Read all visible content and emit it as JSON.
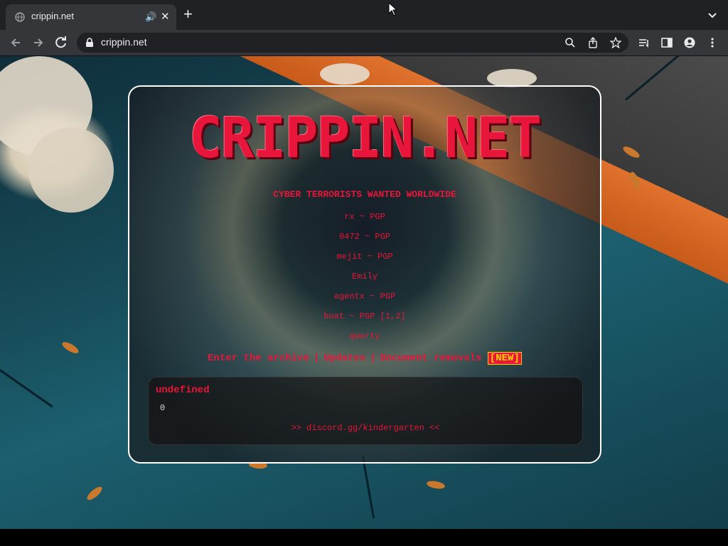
{
  "browser": {
    "tab_title": "crippin.net",
    "url": "crippin.net",
    "icons": [
      "globe-icon",
      "audio-icon",
      "close-icon",
      "new-tab-icon",
      "tab-search-icon",
      "back-icon",
      "forward-icon",
      "reload-icon",
      "lock-icon",
      "zoom-icon",
      "share-icon",
      "bookmark-star-icon",
      "reading-list-icon",
      "side-panel-icon",
      "profile-icon",
      "menu-icon"
    ]
  },
  "page": {
    "logo": "CRIPPIN.NET",
    "heading": "CYBER TERRORISTS WANTED WORLDWIDE",
    "members": [
      "rx ~ PGP",
      "0472 ~ PGP",
      "mejit ~ PGP",
      "Emily",
      "agentx ~ PGP",
      "boat ~ PGP [1,2]",
      "qwerty"
    ],
    "nav": {
      "archive": "Enter the archive",
      "updates": "Updates",
      "removals": "Document removals",
      "new_badge": "[NEW]",
      "separator": "|"
    },
    "chat": {
      "title": "undefined",
      "value": "0",
      "link": ">> discord.gg/kindergarten <<"
    },
    "colors": {
      "accent": "#e8163a",
      "badge_text": "#ffd000"
    }
  }
}
